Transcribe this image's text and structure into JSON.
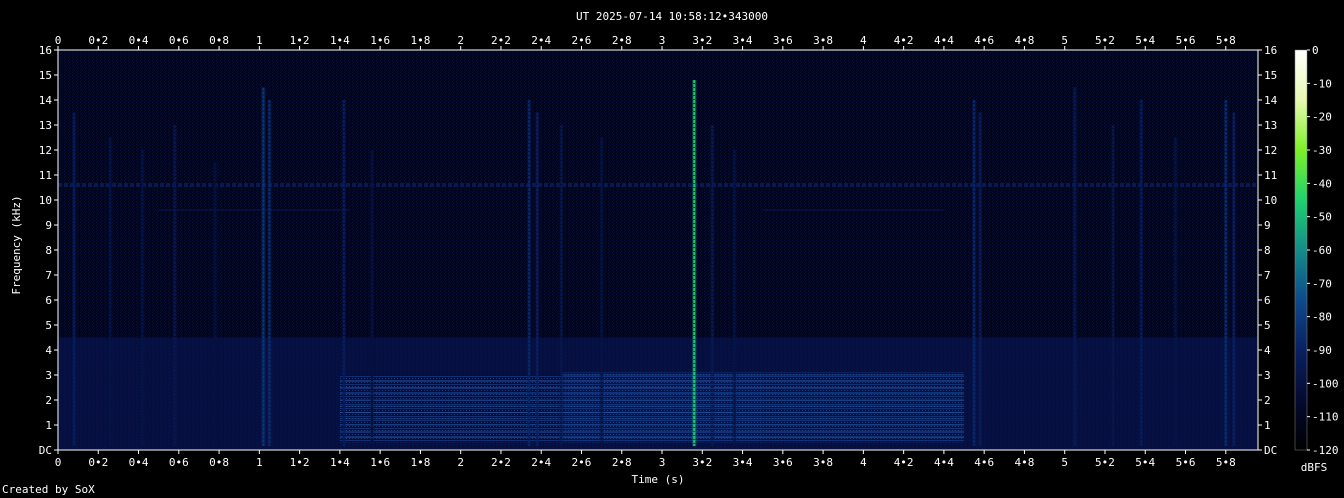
{
  "chart_data": {
    "type": "heatmap",
    "title": "UT 2025-07-14 10:58:12•343000",
    "xlabel": "Time (s)",
    "ylabel": "Frequency (kHz)",
    "xlim": [
      0,
      5.96
    ],
    "ylim": [
      0,
      16
    ],
    "x_ticks": [
      "0",
      "0•2",
      "0•4",
      "0•6",
      "0•8",
      "1",
      "1•2",
      "1•4",
      "1•6",
      "1•8",
      "2",
      "2•2",
      "2•4",
      "2•6",
      "2•8",
      "3",
      "3•2",
      "3•4",
      "3•6",
      "3•8",
      "4",
      "4•2",
      "4•4",
      "4•6",
      "4•8",
      "5",
      "5•2",
      "5•4",
      "5•6",
      "5•8"
    ],
    "y_ticks": [
      "DC",
      "1",
      "2",
      "3",
      "4",
      "5",
      "6",
      "7",
      "8",
      "9",
      "10",
      "11",
      "12",
      "13",
      "14",
      "15",
      "16"
    ],
    "colorbar": {
      "label": "dBFS",
      "range": [
        -120,
        0
      ],
      "ticks": [
        "0",
        "-10",
        "-20",
        "-30",
        "-40",
        "-50",
        "-60",
        "-70",
        "-80",
        "-90",
        "-100",
        "-110",
        "-120"
      ],
      "stops": [
        "#000000",
        "#050a30",
        "#0a2060",
        "#0e4a8a",
        "#148c8a",
        "#1ed26e",
        "#7cf028",
        "#e8f8b0",
        "#ffffff"
      ]
    },
    "background_color": "#02041a",
    "noise_color": "#07124a",
    "hum_line": {
      "freq_khz": 10.6,
      "level_db": -95
    },
    "faint_lines": [
      {
        "t0": 0.5,
        "t1": 1.45,
        "freq_khz": 9.6,
        "level_db": -100
      },
      {
        "t0": 3.5,
        "t1": 4.4,
        "freq_khz": 9.6,
        "level_db": -100
      }
    ],
    "bands": [
      {
        "t0": 2.5,
        "t1": 3.5,
        "f0": 0.3,
        "f1": 3.1,
        "level_db": -96
      },
      {
        "t0": 3.5,
        "t1": 4.5,
        "f0": 0.3,
        "f1": 3.1,
        "level_db": -98
      },
      {
        "t0": 1.4,
        "t1": 2.5,
        "f0": 0.3,
        "f1": 3.0,
        "level_db": -102
      }
    ],
    "transients": [
      {
        "t": 0.08,
        "top_khz": 13.5,
        "level_db": -92
      },
      {
        "t": 0.26,
        "top_khz": 12.5,
        "level_db": -98
      },
      {
        "t": 0.42,
        "top_khz": 12.0,
        "level_db": -98
      },
      {
        "t": 0.58,
        "top_khz": 13.0,
        "level_db": -96
      },
      {
        "t": 0.78,
        "top_khz": 11.5,
        "level_db": -100
      },
      {
        "t": 1.02,
        "top_khz": 14.5,
        "level_db": -82
      },
      {
        "t": 1.05,
        "top_khz": 14.0,
        "level_db": -86
      },
      {
        "t": 1.42,
        "top_khz": 14.0,
        "level_db": -92
      },
      {
        "t": 1.56,
        "top_khz": 12.0,
        "level_db": -100
      },
      {
        "t": 2.34,
        "top_khz": 14.0,
        "level_db": -88
      },
      {
        "t": 2.38,
        "top_khz": 13.5,
        "level_db": -90
      },
      {
        "t": 2.5,
        "top_khz": 13.0,
        "level_db": -96
      },
      {
        "t": 2.7,
        "top_khz": 12.5,
        "level_db": -98
      },
      {
        "t": 3.16,
        "top_khz": 14.8,
        "level_db": -48
      },
      {
        "t": 3.25,
        "top_khz": 13.0,
        "level_db": -94
      },
      {
        "t": 3.36,
        "top_khz": 12.0,
        "level_db": -98
      },
      {
        "t": 4.55,
        "top_khz": 14.0,
        "level_db": -88
      },
      {
        "t": 4.58,
        "top_khz": 13.5,
        "level_db": -92
      },
      {
        "t": 5.05,
        "top_khz": 14.5,
        "level_db": -94
      },
      {
        "t": 5.24,
        "top_khz": 13.0,
        "level_db": -96
      },
      {
        "t": 5.38,
        "top_khz": 14.0,
        "level_db": -92
      },
      {
        "t": 5.55,
        "top_khz": 12.5,
        "level_db": -98
      },
      {
        "t": 5.8,
        "top_khz": 14.0,
        "level_db": -86
      },
      {
        "t": 5.84,
        "top_khz": 13.5,
        "level_db": -90
      }
    ]
  },
  "footer": {
    "credit": "Created by SoX"
  }
}
